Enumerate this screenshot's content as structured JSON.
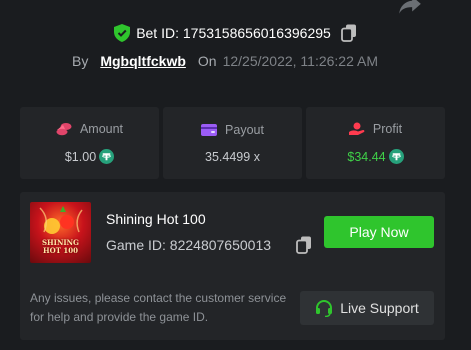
{
  "bet": {
    "id_text": "Bet ID: 1753158656016396295",
    "by_label": "By",
    "user": "Mgbqltfckwb",
    "on_label": "On",
    "date": "12/25/2022, 11:26:22 AM"
  },
  "stats": [
    {
      "label": "Amount",
      "value": "$1.00",
      "icon": "coins-icon",
      "currency_icon": "tether-icon"
    },
    {
      "label": "Payout",
      "value": "35.4499 x",
      "icon": "wallet-icon"
    },
    {
      "label": "Profit",
      "value": "$34.44",
      "icon": "hand-coin-icon",
      "currency_icon": "tether-icon"
    }
  ],
  "game": {
    "name": "Shining Hot 100",
    "id_text": "Game ID: 8224807650013",
    "thumb_text_line1": "SHINING",
    "thumb_text_line2": "HOT 100",
    "play_label": "Play Now"
  },
  "support": {
    "help_text": "Any issues, please contact the customer service for help and provide the game ID.",
    "live_label": "Live Support"
  },
  "colors": {
    "background": "#1a1c1f",
    "card": "#232528",
    "accent_green": "#2fc52d",
    "profit_green": "#3fd048",
    "tether": "#26a17b"
  }
}
